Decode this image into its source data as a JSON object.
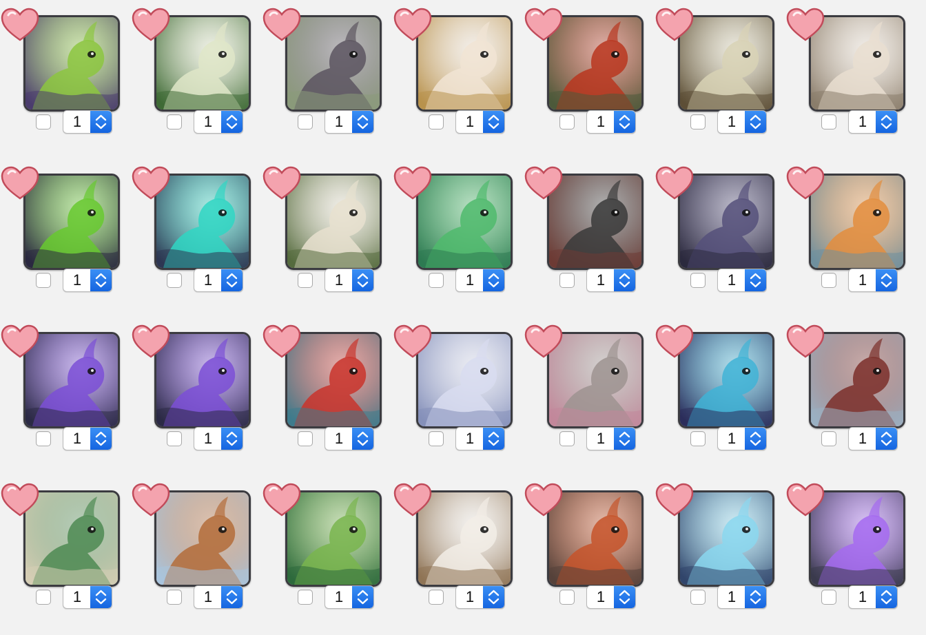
{
  "colors": {
    "page_background": "#f2f2f2",
    "heart_fill": "#f4a3ae",
    "heart_outline": "#c14b5a",
    "stepper_accent": "#1f6fe8"
  },
  "icons": {
    "favorite": "heart-icon",
    "stepper": "up-down-chevron-icon"
  },
  "items": [
    {
      "art": "green-hooded-creature-icon",
      "bg": "#4b3d6e",
      "accent": "#8cc63f",
      "quantity": "1",
      "favorited": true,
      "checked": false
    },
    {
      "art": "moth-dragon-green-icon",
      "bg": "#3e6a35",
      "accent": "#dfe6c8",
      "quantity": "1",
      "favorited": true,
      "checked": false
    },
    {
      "art": "mouse-icon",
      "bg": "#8b9a7a",
      "accent": "#5c5560",
      "quantity": "1",
      "favorited": true,
      "checked": false
    },
    {
      "art": "white-ram-dragon-icon",
      "bg": "#b8924d",
      "accent": "#f1e4d4",
      "quantity": "1",
      "favorited": true,
      "checked": false
    },
    {
      "art": "red-mushroom-icon",
      "bg": "#4d5a3a",
      "accent": "#b8361f",
      "quantity": "1",
      "favorited": true,
      "checked": false
    },
    {
      "art": "skeleton-dragon-icon",
      "bg": "#5d4f36",
      "accent": "#d8d2b5",
      "quantity": "1",
      "favorited": true,
      "checked": false
    },
    {
      "art": "horned-beast-icon",
      "bg": "#8b7d6b",
      "accent": "#e9ded0",
      "quantity": "1",
      "favorited": true,
      "checked": false
    },
    {
      "art": "black-raven-dragon-icon",
      "bg": "#2a2840",
      "accent": "#67c92f",
      "quantity": "1",
      "favorited": true,
      "checked": false
    },
    {
      "art": "grey-raven-dragon-icon",
      "bg": "#2d3752",
      "accent": "#2fd6c3",
      "quantity": "1",
      "favorited": true,
      "checked": false
    },
    {
      "art": "moth-dragon-white-icon",
      "bg": "#556b3e",
      "accent": "#e7e1cf",
      "quantity": "1",
      "favorited": true,
      "checked": false
    },
    {
      "art": "green-bird-dragon-icon",
      "bg": "#2e7a52",
      "accent": "#4fba6c",
      "quantity": "1",
      "favorited": true,
      "checked": false
    },
    {
      "art": "green-eyed-bat-icon",
      "bg": "#6d3b34",
      "accent": "#3a3a3a",
      "quantity": "1",
      "favorited": true,
      "checked": false
    },
    {
      "art": "purple-crow-dragon-icon",
      "bg": "#2c2a3e",
      "accent": "#55507a",
      "quantity": "1",
      "favorited": true,
      "checked": false
    },
    {
      "art": "tusked-orange-beast-icon",
      "bg": "#6f8f9e",
      "accent": "#e38d3d",
      "quantity": "1",
      "favorited": true,
      "checked": false
    },
    {
      "art": "violet-dragon-icon",
      "bg": "#2b2a45",
      "accent": "#7b4fd6",
      "quantity": "1",
      "favorited": true,
      "checked": false
    },
    {
      "art": "violet-dragon-icon",
      "bg": "#2b2a45",
      "accent": "#7b4fd6",
      "quantity": "1",
      "favorited": true,
      "checked": false
    },
    {
      "art": "red-bird-dragon-icon",
      "bg": "#3e7b8c",
      "accent": "#c9342c",
      "quantity": "1",
      "favorited": true,
      "checked": false
    },
    {
      "art": "lilac-dragon-icon",
      "bg": "#8590b9",
      "accent": "#d8dcf0",
      "quantity": "1",
      "favorited": true,
      "checked": false
    },
    {
      "art": "red-eyed-bat-icon",
      "bg": "#c2879a",
      "accent": "#9d9390",
      "quantity": "1",
      "favorited": true,
      "checked": false
    },
    {
      "art": "blue-mushroom-icon",
      "bg": "#2c2e5b",
      "accent": "#3fb3d6",
      "quantity": "1",
      "favorited": true,
      "checked": false
    },
    {
      "art": "red-haired-figure-icon",
      "bg": "#9ab0c2",
      "accent": "#7b2f2a",
      "quantity": "1",
      "favorited": true,
      "checked": false
    },
    {
      "art": "grey-llama-icon",
      "bg": "#d6cdb4",
      "accent": "#4e8a52",
      "quantity": "1",
      "favorited": true,
      "checked": false
    },
    {
      "art": "cream-llama-icon",
      "bg": "#a9c4dd",
      "accent": "#b36c3a",
      "quantity": "1",
      "favorited": true,
      "checked": false
    },
    {
      "art": "green-plant-dragon-icon",
      "bg": "#2e6a3c",
      "accent": "#79b54d",
      "quantity": "1",
      "favorited": true,
      "checked": false
    },
    {
      "art": "brown-owl-icon",
      "bg": "#8f7456",
      "accent": "#f2ede6",
      "quantity": "1",
      "favorited": true,
      "checked": false
    },
    {
      "art": "orange-owl-icon",
      "bg": "#55423a",
      "accent": "#c5542a",
      "quantity": "1",
      "favorited": true,
      "checked": false
    },
    {
      "art": "stone-crackle-dragon-icon",
      "bg": "#32466b",
      "accent": "#8ad7ef",
      "quantity": "1",
      "favorited": true,
      "checked": false
    },
    {
      "art": "shadow-wolf-icon",
      "bg": "#3a3a4d",
      "accent": "#a46af0",
      "quantity": "1",
      "favorited": true,
      "checked": false
    }
  ]
}
